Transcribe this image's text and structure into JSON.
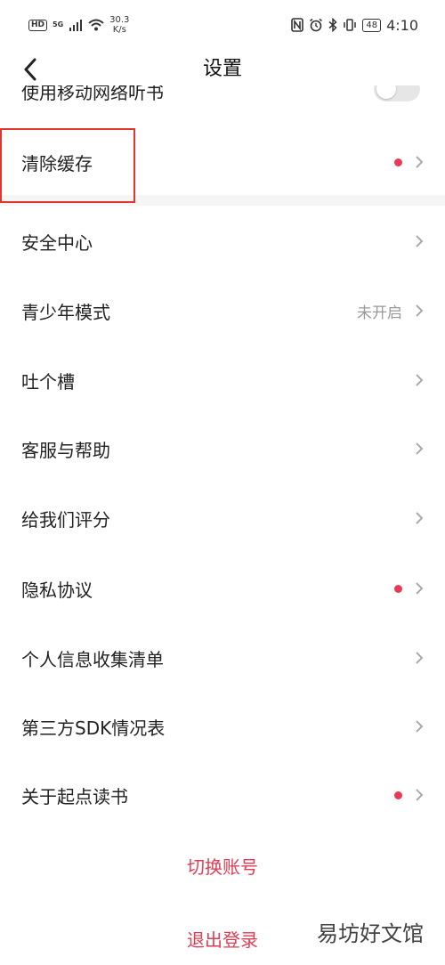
{
  "status_bar": {
    "hd": "HD",
    "network": "5G",
    "speed_value": "30.3",
    "speed_unit": "K/s",
    "battery": "48",
    "time": "4:10"
  },
  "header": {
    "title": "设置"
  },
  "partial_row": {
    "label": "使用移动网络听书"
  },
  "rows": [
    {
      "label": "清除缓存",
      "dot": true,
      "value": ""
    },
    {
      "label": "安全中心",
      "dot": false,
      "value": ""
    },
    {
      "label": "青少年模式",
      "dot": false,
      "value": "未开启"
    },
    {
      "label": "吐个槽",
      "dot": false,
      "value": ""
    },
    {
      "label": "客服与帮助",
      "dot": false,
      "value": ""
    },
    {
      "label": "给我们评分",
      "dot": false,
      "value": ""
    },
    {
      "label": "隐私协议",
      "dot": true,
      "value": ""
    },
    {
      "label": "个人信息收集清单",
      "dot": false,
      "value": ""
    },
    {
      "label": "第三方SDK情况表",
      "dot": false,
      "value": ""
    },
    {
      "label": "关于起点读书",
      "dot": true,
      "value": ""
    }
  ],
  "actions": {
    "switch_account": "切换账号",
    "logout": "退出登录"
  },
  "watermark": "易坊好文馆",
  "colors": {
    "accent": "#e23c54",
    "dot": "#ec3a55",
    "highlight": "#e0362e"
  }
}
